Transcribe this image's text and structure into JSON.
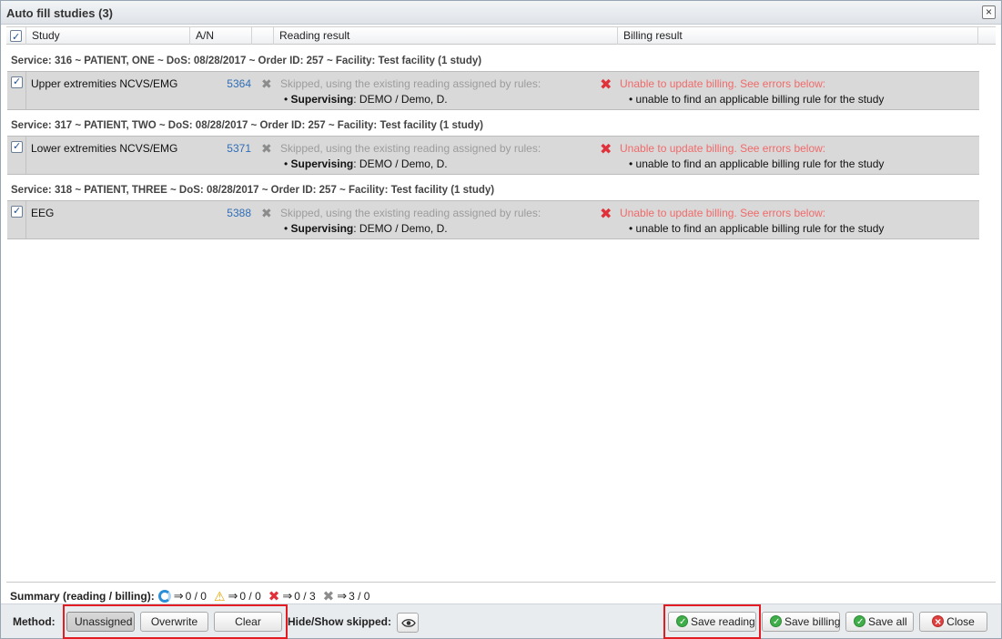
{
  "window": {
    "title": "Auto fill studies (3)",
    "close_glyph": "×"
  },
  "columns": {
    "study": "Study",
    "an": "A/N",
    "reading": "Reading result",
    "billing": "Billing result"
  },
  "groups": [
    {
      "header": "Service: 316 ~ PATIENT, ONE ~ DoS: 08/28/2017 ~ Order ID: 257 ~ Facility: Test facility (1 study)",
      "study": "Upper extremities NCVS/EMG",
      "an": "5364",
      "reading_msg": "Skipped, using the existing reading assigned by rules:",
      "sup_label": "Supervising",
      "sup_value": ": DEMO / Demo, D.",
      "billing_msg": "Unable to update billing. See errors below:",
      "billing_detail": "unable to find an applicable billing rule for the study"
    },
    {
      "header": "Service: 317 ~ PATIENT, TWO ~ DoS: 08/28/2017 ~ Order ID: 257 ~ Facility: Test facility (1 study)",
      "study": "Lower extremities NCVS/EMG",
      "an": "5371",
      "reading_msg": "Skipped, using the existing reading assigned by rules:",
      "sup_label": "Supervising",
      "sup_value": ": DEMO / Demo, D.",
      "billing_msg": "Unable to update billing. See errors below:",
      "billing_detail": "unable to find an applicable billing rule for the study"
    },
    {
      "header": "Service: 318 ~ PATIENT, THREE ~ DoS: 08/28/2017 ~ Order ID: 257 ~ Facility: Test facility (1 study)",
      "study": "EEG",
      "an": "5388",
      "reading_msg": "Skipped, using the existing reading assigned by rules:",
      "sup_label": "Supervising",
      "sup_value": ": DEMO / Demo, D.",
      "billing_msg": "Unable to update billing. See errors below:",
      "billing_detail": "unable to find an applicable billing rule for the study"
    }
  ],
  "summary": {
    "label": "Summary (reading / billing):",
    "arrow": "⇒",
    "updated": "0 / 0",
    "warnings": "0 / 0",
    "errors": "0 / 3",
    "skipped": "3 / 0"
  },
  "footer": {
    "method_label": "Method:",
    "unassigned": "Unassigned",
    "overwrite": "Overwrite",
    "clear": "Clear",
    "hide_show": "Hide/Show skipped:",
    "save_reading": "Save reading",
    "save_billing": "Save billing",
    "save_all": "Save all",
    "close": "Close"
  },
  "icons": {
    "skip": "gray-x-icon",
    "error": "red-x-icon",
    "sync": "sync-icon",
    "warning": "warning-icon",
    "eye": "eye-icon"
  },
  "colors": {
    "link": "#2f6db6",
    "error": "#e0303a",
    "error_text": "#f06a6a",
    "highlight": "#e31b23",
    "row_bg": "#d9d9d9"
  }
}
